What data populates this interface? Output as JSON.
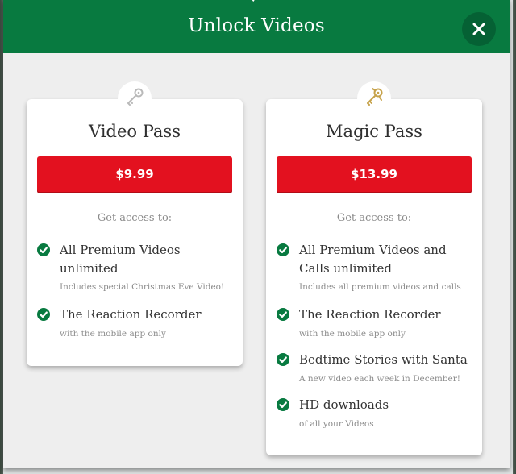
{
  "modal": {
    "title": "Unlock Videos",
    "close_icon": "close-icon"
  },
  "colors": {
    "header_green": "#087a40",
    "price_red": "#e3111f",
    "check_green": "#087a40",
    "key_gold": "#c6a24a",
    "key_silver": "#b9b9b9"
  },
  "cards": [
    {
      "name": "Video Pass",
      "icon": "silver-key-icon",
      "price": "$9.99",
      "access_label": "Get access to:",
      "features": [
        {
          "title": "All Premium Videos unlimited",
          "sub": "Includes special Christmas Eve Video!"
        },
        {
          "title": "The Reaction Recorder",
          "sub": "with the mobile app only"
        }
      ]
    },
    {
      "name": "Magic Pass",
      "icon": "gold-key-icon",
      "price": "$13.99",
      "access_label": "Get access to:",
      "features": [
        {
          "title": "All Premium Videos and Calls unlimited",
          "sub": "Includes all premium videos and calls"
        },
        {
          "title": "The Reaction Recorder",
          "sub": "with the mobile app only"
        },
        {
          "title": "Bedtime Stories with Santa",
          "sub": "A new video each week in December!"
        },
        {
          "title": "HD downloads",
          "sub": "of all your Videos"
        }
      ]
    }
  ]
}
